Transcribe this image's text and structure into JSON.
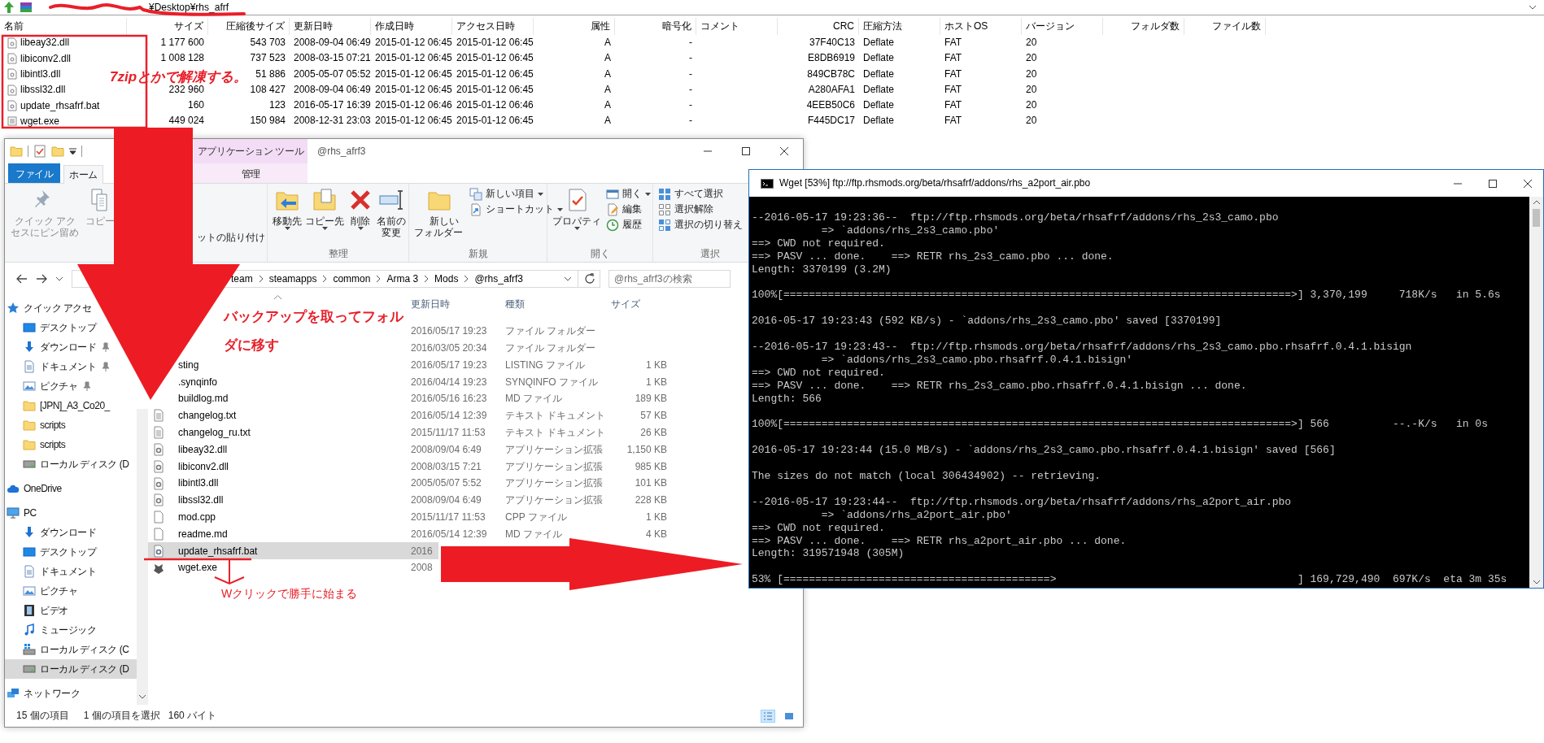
{
  "archive": {
    "path": "¥Desktop¥rhs_afrf",
    "columns": [
      "名前",
      "サイズ",
      "圧縮後サイズ",
      "更新日時",
      "作成日時",
      "アクセス日時",
      "属性",
      "暗号化",
      "コメント",
      "CRC",
      "圧縮方法",
      "ホストOS",
      "バージョン",
      "フォルダ数",
      "ファイル数"
    ],
    "rows": [
      {
        "kind": "dll",
        "name": "libeay32.dll",
        "size": "1 177 600",
        "packed": "543 703",
        "modified": "2008-09-04 06:49",
        "created": "2015-01-12 06:45",
        "accessed": "2015-01-12 06:45",
        "attributes": "A",
        "encrypted": "-",
        "crc": "37F40C13",
        "method": "Deflate",
        "host_os": "FAT",
        "version": "20"
      },
      {
        "kind": "dll",
        "name": "libiconv2.dll",
        "size": "1 008 128",
        "packed": "737 523",
        "modified": "2008-03-15 07:21",
        "created": "2015-01-12 06:45",
        "accessed": "2015-01-12 06:45",
        "attributes": "A",
        "encrypted": "-",
        "crc": "E8DB6919",
        "method": "Deflate",
        "host_os": "FAT",
        "version": "20"
      },
      {
        "kind": "dll",
        "name": "libintl3.dll",
        "packed": "51 886",
        "modified": "2005-05-07 05:52",
        "created": "2015-01-12 06:45",
        "accessed": "2015-01-12 06:45",
        "attributes": "A",
        "encrypted": "-",
        "crc": "849CB78C",
        "method": "Deflate",
        "host_os": "FAT",
        "version": "20"
      },
      {
        "kind": "dll",
        "name": "libssl32.dll",
        "size": "232 960",
        "packed": "108 427",
        "modified": "2008-09-04 06:49",
        "created": "2015-01-12 06:45",
        "accessed": "2015-01-12 06:45",
        "attributes": "A",
        "encrypted": "-",
        "crc": "A280AFA1",
        "method": "Deflate",
        "host_os": "FAT",
        "version": "20"
      },
      {
        "kind": "bat",
        "name": "update_rhsafrf.bat",
        "size": "160",
        "packed": "123",
        "modified": "2016-05-17 16:39",
        "created": "2015-01-12 06:46",
        "accessed": "2015-01-12 06:46",
        "attributes": "A",
        "encrypted": "-",
        "crc": "4EEB50C6",
        "method": "Deflate",
        "host_os": "FAT",
        "version": "20"
      },
      {
        "kind": "exe",
        "name": "wget.exe",
        "size": "449 024",
        "packed": "150 984",
        "modified": "2008-12-31 23:03",
        "created": "2015-01-12 06:45",
        "accessed": "2015-01-12 06:45",
        "attributes": "A",
        "encrypted": "-",
        "crc": "F445DC17",
        "method": "Deflate",
        "host_os": "FAT",
        "version": "20"
      }
    ]
  },
  "explorer": {
    "title": "@rhs_afrf3",
    "context_group": "アプリケーション ツール",
    "tabs": [
      {
        "label": "ファイル",
        "kind": "file",
        "selected": false
      },
      {
        "label": "ホーム",
        "kind": "tab",
        "selected": true
      },
      {
        "label": "管理",
        "kind": "context",
        "selected": false
      }
    ],
    "ribbon": [
      {
        "items": [
          {
            "label": "クイック アクセスにピン留め",
            "kind": "large",
            "disabled": true,
            "dropdown": false
          },
          {
            "label": "コピー",
            "kind": "large",
            "disabled": true,
            "dropdown": false
          },
          {
            "label": "ットの貼り付け",
            "kind": "small",
            "disabled": false,
            "dropdown": false
          }
        ]
      },
      {
        "label": "整理",
        "items": [
          {
            "label": "移動先",
            "kind": "large",
            "disabled": false,
            "dropdown": true
          },
          {
            "label": "コピー先",
            "kind": "large",
            "disabled": false,
            "dropdown": true
          },
          {
            "label": "削除",
            "kind": "large",
            "disabled": false,
            "dropdown": true
          },
          {
            "label": "名前の変更",
            "kind": "large",
            "disabled": false,
            "dropdown": false
          }
        ]
      },
      {
        "label": "新規",
        "items": [
          {
            "label": "新しいフォルダー",
            "kind": "large",
            "disabled": false,
            "dropdown": false
          },
          {
            "label": "新しい項目",
            "kind": "small",
            "disabled": false,
            "dropdown": true
          },
          {
            "label": "ショートカット",
            "kind": "small",
            "disabled": false,
            "dropdown": true
          }
        ]
      },
      {
        "label": "開く",
        "items": [
          {
            "label": "プロパティ",
            "kind": "large",
            "disabled": false,
            "dropdown": true
          },
          {
            "label": "開く",
            "kind": "small",
            "disabled": false,
            "dropdown": true
          },
          {
            "label": "編集",
            "kind": "small",
            "disabled": false,
            "dropdown": false
          },
          {
            "label": "履歴",
            "kind": "small",
            "disabled": false,
            "dropdown": false
          }
        ]
      },
      {
        "label": "選択",
        "items": [
          {
            "label": "すべて選択",
            "kind": "small",
            "disabled": false,
            "dropdown": false
          },
          {
            "label": "選択解除",
            "kind": "small",
            "disabled": false,
            "dropdown": false
          },
          {
            "label": "選択の切り替え",
            "kind": "small",
            "disabled": false,
            "dropdown": false
          }
        ]
      }
    ],
    "breadcrumbs": [
      "team",
      "steamapps",
      "common",
      "Arma 3",
      "Mods",
      "@rhs_afrf3"
    ],
    "search": {
      "placeholder": "@rhs_afrf3の検索"
    },
    "navigation": [
      {
        "label": "クイック アクセ",
        "kind": "quick-access",
        "selected": false,
        "children": [
          {
            "label": "デスクトップ",
            "kind": "desktop",
            "pinned": false,
            "selected": false
          },
          {
            "label": "ダウンロード",
            "kind": "downloads",
            "pinned": true,
            "selected": false
          },
          {
            "label": "ドキュメント",
            "kind": "documents",
            "pinned": true,
            "selected": false
          },
          {
            "label": "ピクチャ",
            "kind": "pictures",
            "pinned": true,
            "selected": false
          },
          {
            "label": "[JPN]_A3_Co20_",
            "kind": "folder",
            "pinned": false,
            "selected": false
          },
          {
            "label": "scripts",
            "kind": "folder",
            "pinned": false,
            "selected": false
          },
          {
            "label": "scripts",
            "kind": "folder",
            "pinned": false,
            "selected": false
          },
          {
            "label": "ローカル ディスク (D",
            "kind": "drive",
            "pinned": false,
            "selected": false
          }
        ]
      },
      {
        "label": "OneDrive",
        "kind": "cloud",
        "selected": false
      },
      {
        "label": "PC",
        "kind": "pc",
        "selected": false,
        "children": [
          {
            "label": "ダウンロード",
            "kind": "downloads",
            "pinned": false,
            "selected": false
          },
          {
            "label": "デスクトップ",
            "kind": "desktop",
            "pinned": false,
            "selected": false
          },
          {
            "label": "ドキュメント",
            "kind": "documents",
            "pinned": false,
            "selected": false
          },
          {
            "label": "ピクチャ",
            "kind": "pictures",
            "pinned": false,
            "selected": false
          },
          {
            "label": "ビデオ",
            "kind": "videos",
            "pinned": false,
            "selected": false
          },
          {
            "label": "ミュージック",
            "kind": "music",
            "pinned": false,
            "selected": false
          },
          {
            "label": "ローカル ディスク (C",
            "kind": "drive-system",
            "pinned": false,
            "selected": false
          },
          {
            "label": "ローカル ディスク (D",
            "kind": "drive",
            "pinned": false,
            "selected": true
          }
        ]
      },
      {
        "label": "ネットワーク",
        "kind": "network",
        "selected": false
      }
    ],
    "columns": [
      "更新日時",
      "種類",
      "サイズ"
    ],
    "files": [
      {
        "modified": "2016/05/17 19:23",
        "type": "ファイル フォルダー",
        "selected": false
      },
      {
        "modified": "2016/03/05 20:34",
        "type": "ファイル フォルダー",
        "selected": false
      },
      {
        "name": "sting",
        "modified": "2016/05/17 19:23",
        "type": "LISTING ファイル",
        "size": "1 KB",
        "selected": false
      },
      {
        "name": ".synqinfo",
        "modified": "2016/04/14 19:23",
        "type": "SYNQINFO ファイル",
        "size": "1 KB",
        "selected": false
      },
      {
        "name": "buildlog.md",
        "modified": "2016/05/16 16:23",
        "type": "MD ファイル",
        "size": "189 KB",
        "selected": false
      },
      {
        "kind": "text",
        "name": "changelog.txt",
        "modified": "2016/05/14 12:39",
        "type": "テキスト ドキュメント",
        "size": "57 KB",
        "selected": false
      },
      {
        "kind": "text",
        "name": "changelog_ru.txt",
        "modified": "2015/11/17 11:53",
        "type": "テキスト ドキュメント",
        "size": "26 KB",
        "selected": false
      },
      {
        "kind": "dll",
        "name": "libeay32.dll",
        "modified": "2008/09/04 6:49",
        "type": "アプリケーション拡張",
        "size": "1,150 KB",
        "selected": false
      },
      {
        "kind": "dll",
        "name": "libiconv2.dll",
        "modified": "2008/03/15 7:21",
        "type": "アプリケーション拡張",
        "size": "985 KB",
        "selected": false
      },
      {
        "kind": "dll",
        "name": "libintl3.dll",
        "modified": "2005/05/07 5:52",
        "type": "アプリケーション拡張",
        "size": "101 KB",
        "selected": false
      },
      {
        "kind": "dll",
        "name": "libssl32.dll",
        "modified": "2008/09/04 6:49",
        "type": "アプリケーション拡張",
        "size": "228 KB",
        "selected": false
      },
      {
        "kind": "doc",
        "name": "mod.cpp",
        "modified": "2015/11/17 11:53",
        "type": "CPP ファイル",
        "size": "1 KB",
        "selected": false
      },
      {
        "kind": "doc",
        "name": "readme.md",
        "modified": "2016/05/14 12:39",
        "type": "MD ファイル",
        "size": "4 KB",
        "selected": false
      },
      {
        "kind": "bat",
        "name": "update_rhsafrf.bat",
        "modified": "2016",
        "selected": true
      },
      {
        "kind": "exe",
        "name": "wget.exe",
        "modified": "2008",
        "selected": false
      }
    ],
    "status": {
      "count": "15 個の項目",
      "selection": "1 個の項目を選択",
      "size": "160 バイト"
    },
    "views": [
      {
        "kind": "details",
        "selected": true
      },
      {
        "kind": "large-icons",
        "selected": false
      }
    ]
  },
  "terminal": {
    "title": "Wget [53%] ftp://ftp.rhsmods.org/beta/rhsafrf/addons/rhs_a2port_air.pbo",
    "blocks": [
      [
        "--2016-05-17 19:23:36--  ftp://ftp.rhsmods.org/beta/rhsafrf/addons/rhs_2s3_camo.pbo",
        "           => `addons/rhs_2s3_camo.pbo'",
        "==> CWD not required.",
        "==> PASV ... done.    ==> RETR rhs_2s3_camo.pbo ... done.",
        "Length: 3370199 (3.2M)"
      ],
      [
        "100%[================================================================================>] 3,370,199     718K/s   in 5.6s"
      ],
      [
        "2016-05-17 19:23:43 (592 KB/s) - `addons/rhs_2s3_camo.pbo' saved [3370199]"
      ],
      [
        "--2016-05-17 19:23:43--  ftp://ftp.rhsmods.org/beta/rhsafrf/addons/rhs_2s3_camo.pbo.rhsafrf.0.4.1.bisign",
        "           => `addons/rhs_2s3_camo.pbo.rhsafrf.0.4.1.bisign'",
        "==> CWD not required.",
        "==> PASV ... done.    ==> RETR rhs_2s3_camo.pbo.rhsafrf.0.4.1.bisign ... done.",
        "Length: 566"
      ],
      [
        "100%[================================================================================>] 566          --.-K/s   in 0s"
      ],
      [
        "2016-05-17 19:23:44 (15.0 MB/s) - `addons/rhs_2s3_camo.pbo.rhsafrf.0.4.1.bisign' saved [566]"
      ],
      [
        "The sizes do not match (local 306434902) -- retrieving."
      ],
      [
        "--2016-05-17 19:23:44--  ftp://ftp.rhsmods.org/beta/rhsafrf/addons/rhs_a2port_air.pbo",
        "           => `addons/rhs_a2port_air.pbo'",
        "==> CWD not required.",
        "==> PASV ... done.    ==> RETR rhs_a2port_air.pbo ... done.",
        "Length: 319571948 (305M)"
      ],
      [
        "53% [==========================================>                                      ] 169,729,490  697K/s  eta 3m 35s"
      ]
    ]
  },
  "annotations": [
    {
      "kind": "italic-note",
      "text": "7zipとかで解凍する。"
    },
    {
      "kind": "bold-note",
      "text": "バックアップを取ってフォルダに移す"
    },
    {
      "kind": "plain-note",
      "text": "Wクリックで勝手に始まる"
    }
  ]
}
